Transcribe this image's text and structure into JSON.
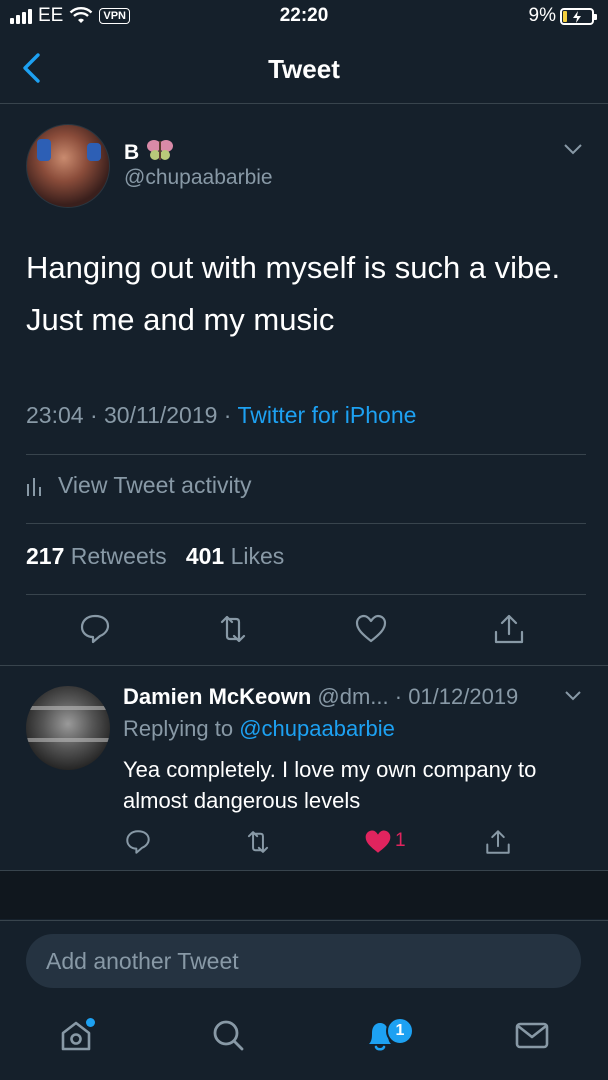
{
  "status_bar": {
    "carrier": "EE",
    "vpn": "VPN",
    "time": "22:20",
    "battery": "9%"
  },
  "nav": {
    "title": "Tweet"
  },
  "tweet": {
    "display_name": "B",
    "handle": "@chupaabarbie",
    "text": "Hanging out with myself is such a vibe. Just me and my music",
    "time": "23:04",
    "date": "30/11/2019",
    "source": "Twitter for iPhone",
    "activity_label": "View Tweet activity",
    "retweets": "217",
    "retweets_label": "Retweets",
    "likes": "401",
    "likes_label": "Likes"
  },
  "reply": {
    "name": "Damien McKeown",
    "handle": "@dm...",
    "date": "01/12/2019",
    "replying_prefix": "Replying to",
    "replying_to": "@chupaabarbie",
    "text": "Yea completely. I love my own company to almost dangerous levels",
    "like_count": "1"
  },
  "compose": {
    "placeholder": "Add another Tweet"
  },
  "tabbar": {
    "notifications_badge": "1"
  },
  "colors": {
    "background": "#15202b",
    "accent": "#1da1f2",
    "muted": "#8899a6",
    "like": "#e0245e",
    "divider": "#38444d"
  }
}
